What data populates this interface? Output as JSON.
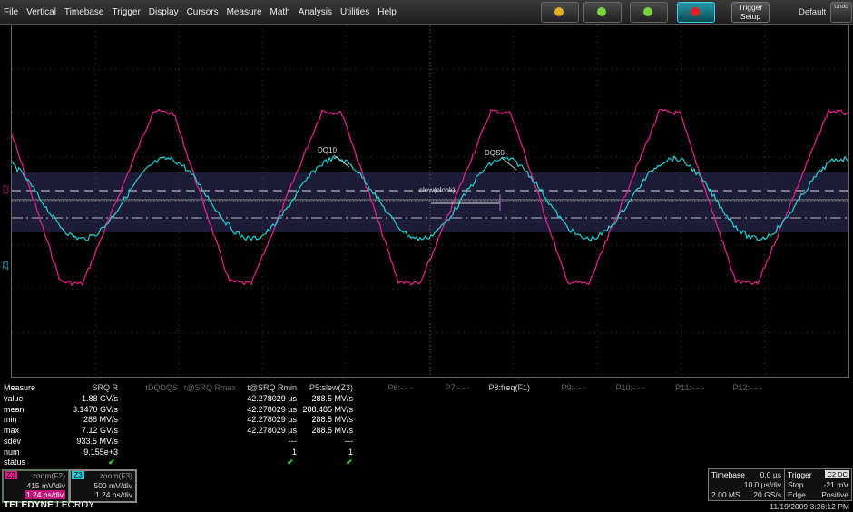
{
  "menu": [
    "File",
    "Vertical",
    "Timebase",
    "Trigger",
    "Display",
    "Cursors",
    "Measure",
    "Math",
    "Analysis",
    "Utilities",
    "Help"
  ],
  "toolbar": {
    "trigger_setup": "Trigger Setup",
    "default": "Default",
    "undo": "Undo",
    "status_colors": [
      "#e0b020",
      "#7ad23c",
      "#7ad23c",
      "#e02020"
    ]
  },
  "waveform_labels": {
    "dq10": "DQ10",
    "dqs0": "DQS0",
    "slew": "slew(clock)"
  },
  "side_markers": [
    "C2",
    "Z3"
  ],
  "measure": {
    "title": "Measure",
    "headers": [
      "SRQ R",
      "tDQDQS",
      "t@SRQ Rmax",
      "t@SRQ Rmin",
      "P5:slew(Z3)",
      "P6:- - -",
      "P7:- - -",
      "P8:freq(F1)",
      "P9:- - -",
      "P10:- - -",
      "P11:- - -",
      "P12:- - -"
    ],
    "rows": [
      {
        "label": "value",
        "c1": "1.88 GV/s",
        "c4": "42.278029 µs",
        "c5": "288.5 MV/s"
      },
      {
        "label": "mean",
        "c1": "3.1470 GV/s",
        "c4": "42.278029 µs",
        "c5": "288.485 MV/s"
      },
      {
        "label": "min",
        "c1": "288 MV/s",
        "c4": "42.278029 µs",
        "c5": "288.5 MV/s"
      },
      {
        "label": "max",
        "c1": "7.12 GV/s",
        "c4": "42.278029 µs",
        "c5": "288.5 MV/s"
      },
      {
        "label": "sdev",
        "c1": "933.5 MV/s",
        "c4": "---",
        "c5": "---"
      },
      {
        "label": "num",
        "c1": "9.155e+3",
        "c4": "1",
        "c5": "1"
      },
      {
        "label": "status",
        "c1": "✔",
        "c4": "✔",
        "c5": "✔"
      }
    ]
  },
  "descriptors": [
    {
      "tag": "Z2",
      "name": "zoom(F2)",
      "scale": "415 mV/div",
      "time": "1.24 ns/div",
      "color": "#e0208a"
    },
    {
      "tag": "Z3",
      "name": "zoom(F3)",
      "scale": "500 mV/div",
      "time": "1.24 ns/div",
      "color": "#20d0d8"
    }
  ],
  "timebase": {
    "label": "Timebase",
    "offset": "0.0 µs",
    "tdiv": "10.0 µs/div",
    "samples": "2.00 MS",
    "rate": "20 GS/s"
  },
  "trigger": {
    "label": "Trigger",
    "source": "C2 DC",
    "mode": "Stop",
    "level": "-21 mV",
    "type": "Edge",
    "slope": "Positive"
  },
  "brand": {
    "bold": "TELEDYNE",
    "thin": "LECROY"
  },
  "datetime": "11/19/2009 3:28:12 PM"
}
